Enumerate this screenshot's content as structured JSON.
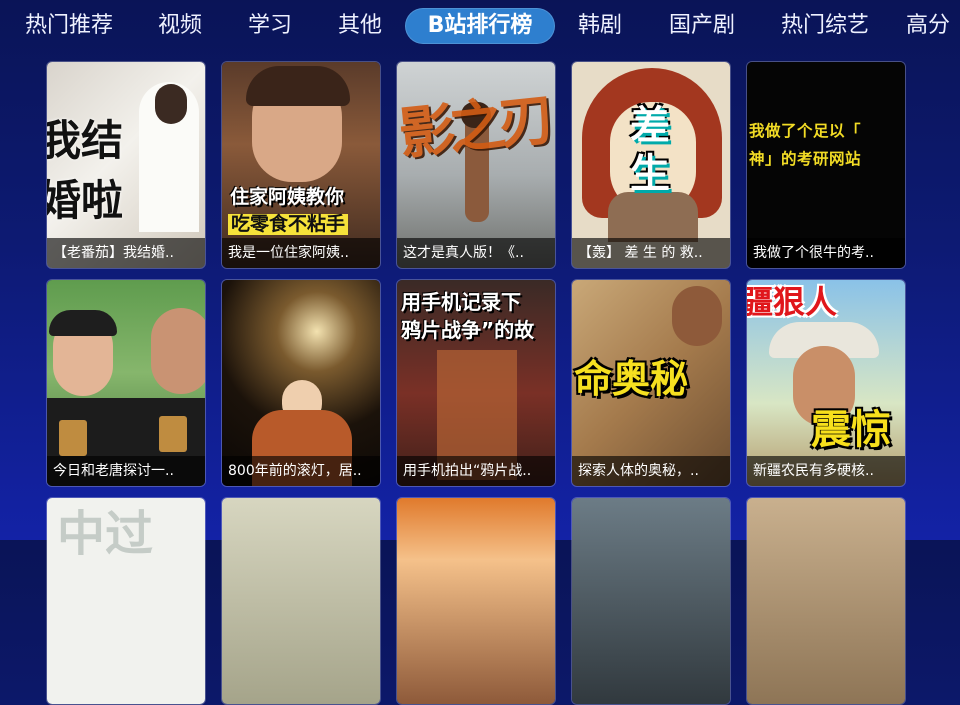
{
  "tabs": [
    {
      "label": "热门推荐",
      "active": false
    },
    {
      "label": "视频",
      "active": false
    },
    {
      "label": "学习",
      "active": false
    },
    {
      "label": "其他",
      "active": false
    },
    {
      "label": "B站排行榜",
      "active": true
    },
    {
      "label": "韩剧",
      "active": false
    },
    {
      "label": "国产剧",
      "active": false
    },
    {
      "label": "热门综艺",
      "active": false
    },
    {
      "label": "高分",
      "active": false
    }
  ],
  "videos": [
    {
      "title": "【老番茄】我结婚..",
      "thumb_text": [
        "我结",
        "婚啦"
      ]
    },
    {
      "title": "我是一位住家阿姨..",
      "thumb_text": [
        "住家阿姨教你",
        "吃零食不粘手"
      ]
    },
    {
      "title": "这才是真人版！《..",
      "thumb_text": [
        "影之刃"
      ]
    },
    {
      "title": "【轰】 差 生 的 救..",
      "thumb_text": [
        "差",
        "生"
      ]
    },
    {
      "title": "我做了个很牛的考..",
      "thumb_text": [
        "我做了个足以「",
        "神」的考研网站"
      ]
    },
    {
      "title": "今日和老唐探讨一..",
      "thumb_text": []
    },
    {
      "title": "800年前的滚灯，居..",
      "thumb_text": []
    },
    {
      "title": "用手机拍出“鸦片战..",
      "thumb_text": [
        "用手机记录下",
        "鸦片战争”的故"
      ]
    },
    {
      "title": "探索人体的奥秘，..",
      "thumb_text": [
        "命奥秘"
      ]
    },
    {
      "title": "新疆农民有多硬核..",
      "thumb_text": [
        "疆狠人",
        "震惊"
      ]
    },
    {
      "title": "",
      "thumb_text": [
        "中过"
      ]
    },
    {
      "title": "",
      "thumb_text": []
    },
    {
      "title": "",
      "thumb_text": []
    },
    {
      "title": "",
      "thumb_text": []
    },
    {
      "title": "",
      "thumb_text": []
    }
  ]
}
